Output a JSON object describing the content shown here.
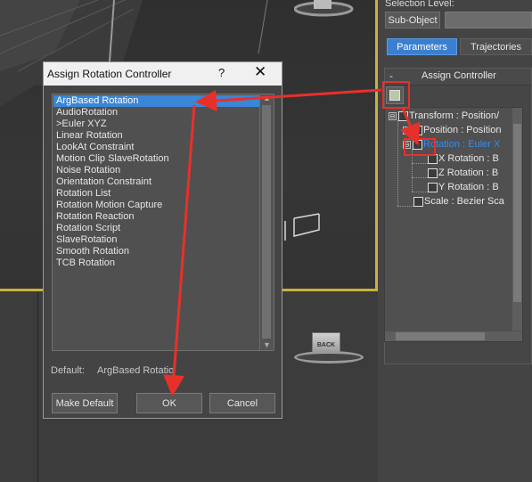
{
  "right_panel": {
    "selection_level_label": "Selection Level:",
    "subobject_button": "Sub-Object",
    "tabs": [
      {
        "label": "Parameters",
        "active": true
      },
      {
        "label": "Trajectories",
        "active": false
      }
    ],
    "rollout": {
      "collapse_symbol": "-",
      "title": "Assign Controller",
      "tree": [
        {
          "label": "Transform : Position/",
          "expand": "⊖",
          "icon": "transform-icon",
          "selected": false
        },
        {
          "label": "Position : Position",
          "expand": "⊕",
          "icon": "position-icon",
          "selected": false
        },
        {
          "label": "Rotation : Euler X",
          "expand": "⊖",
          "icon": "rotation-icon",
          "selected": true
        },
        {
          "label": "X Rotation : B",
          "expand": "",
          "icon": "track-icon",
          "selected": false
        },
        {
          "label": "Z Rotation : B",
          "expand": "",
          "icon": "track-icon",
          "selected": false
        },
        {
          "label": "Y Rotation : B",
          "expand": "",
          "icon": "track-icon",
          "selected": false
        },
        {
          "label": "Scale : Bezier Sca",
          "expand": "",
          "icon": "scale-icon",
          "selected": false
        }
      ]
    }
  },
  "dialog": {
    "title": "Assign Rotation Controller",
    "help_symbol": "?",
    "close_symbol": "✕",
    "controllers": [
      "ArgBased Rotation",
      "AudioRotation",
      ">Euler XYZ",
      "Linear Rotation",
      "LookAt Constraint",
      "Motion Clip SlaveRotation",
      "Noise Rotation",
      "Orientation Constraint",
      "Rotation List",
      "Rotation Motion Capture",
      "Rotation Reaction",
      "Rotation Script",
      "SlaveRotation",
      "Smooth Rotation",
      "TCB Rotation"
    ],
    "selected_index": 0,
    "default_label": "Default:",
    "default_value": "ArgBased Rotatio",
    "buttons": {
      "make_default": "Make Default",
      "ok": "OK",
      "cancel": "Cancel"
    }
  },
  "viewport": {
    "viewcube_label": "BACK",
    "active_border_color": "#c9b23a"
  },
  "colors": {
    "accent": "#3b86d6",
    "annotation": "#e8302a",
    "panel_bg": "#444444"
  }
}
